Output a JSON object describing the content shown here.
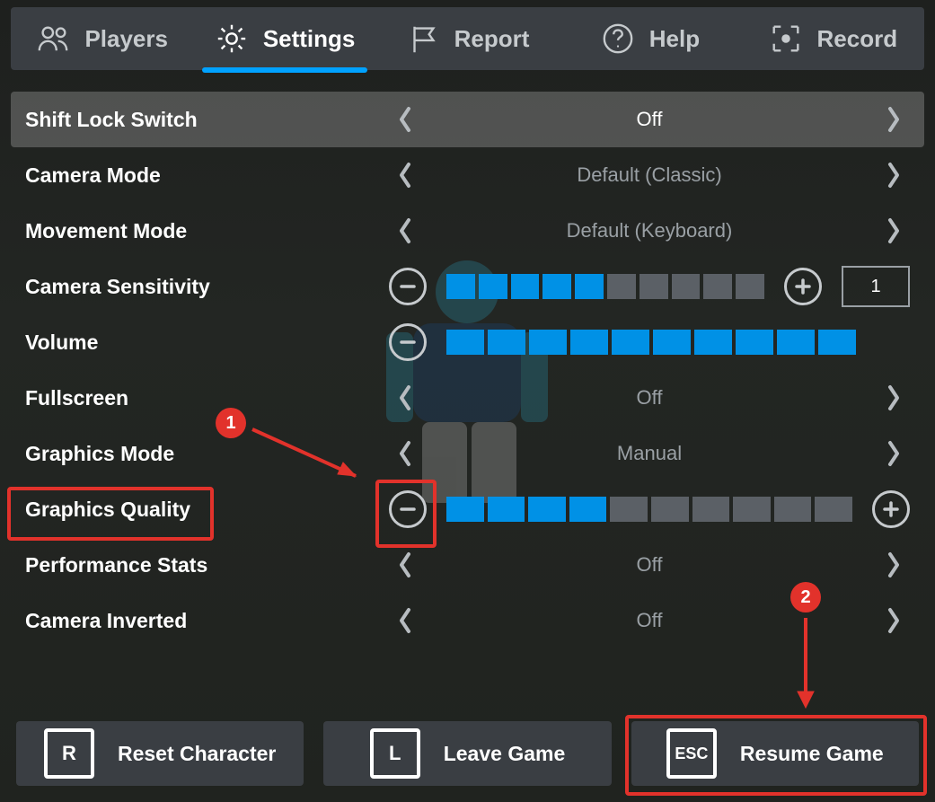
{
  "tabs": {
    "players": "Players",
    "settings": "Settings",
    "report": "Report",
    "help": "Help",
    "record": "Record",
    "active": "settings"
  },
  "settings": {
    "shiftLock": {
      "label": "Shift Lock Switch",
      "value": "Off"
    },
    "cameraMode": {
      "label": "Camera Mode",
      "value": "Default (Classic)"
    },
    "movementMode": {
      "label": "Movement Mode",
      "value": "Default (Keyboard)"
    },
    "cameraSensitivity": {
      "label": "Camera Sensitivity",
      "filled": 5,
      "total": 10,
      "numeric": "1"
    },
    "volume": {
      "label": "Volume",
      "filled": 10,
      "total": 10
    },
    "fullscreen": {
      "label": "Fullscreen",
      "value": "Off"
    },
    "graphicsMode": {
      "label": "Graphics Mode",
      "value": "Manual"
    },
    "graphicsQuality": {
      "label": "Graphics Quality",
      "filled": 4,
      "total": 10
    },
    "performanceStats": {
      "label": "Performance Stats",
      "value": "Off"
    },
    "cameraInverted": {
      "label": "Camera Inverted",
      "value": "Off"
    }
  },
  "bottom": {
    "reset": {
      "key": "R",
      "label": "Reset Character"
    },
    "leave": {
      "key": "L",
      "label": "Leave Game"
    },
    "resume": {
      "key": "ESC",
      "label": "Resume Game"
    }
  },
  "annotations": {
    "badge1": "1",
    "badge2": "2"
  }
}
